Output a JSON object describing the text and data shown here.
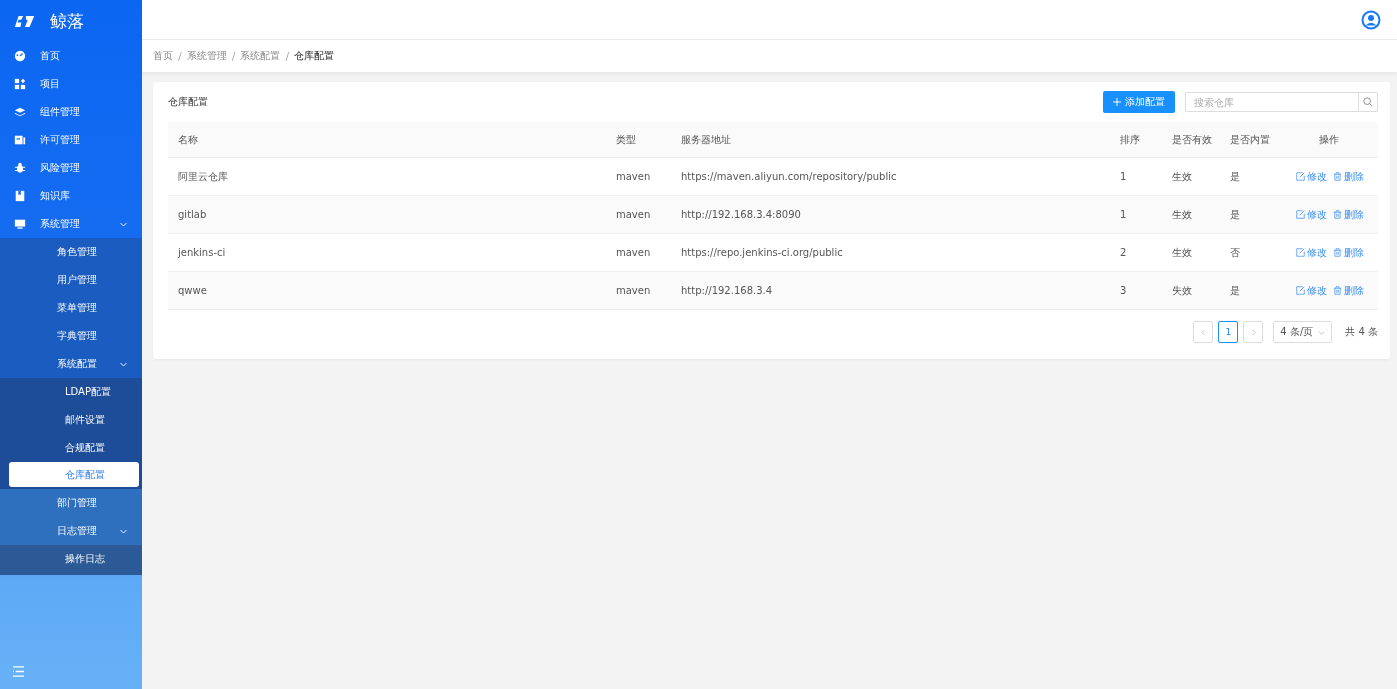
{
  "app": {
    "name": "鲸落"
  },
  "sidebar": {
    "items": [
      {
        "label": "首页",
        "selected": false
      },
      {
        "label": "项目",
        "selected": false
      },
      {
        "label": "组件管理",
        "selected": false
      },
      {
        "label": "许可管理",
        "selected": false
      },
      {
        "label": "风险管理",
        "selected": false
      },
      {
        "label": "知识库",
        "selected": false
      },
      {
        "label": "系统管理",
        "selected": false,
        "expanded": true,
        "children": [
          {
            "label": "角色管理",
            "selected": false
          },
          {
            "label": "用户管理",
            "selected": false
          },
          {
            "label": "菜单管理",
            "selected": false
          },
          {
            "label": "字典管理",
            "selected": false
          },
          {
            "label": "系统配置",
            "selected": false,
            "expanded": true,
            "children": [
              {
                "label": "LDAP配置",
                "selected": false
              },
              {
                "label": "邮件设置",
                "selected": false
              },
              {
                "label": "合规配置",
                "selected": false
              },
              {
                "label": "仓库配置",
                "selected": true
              }
            ]
          },
          {
            "label": "部门管理",
            "selected": false
          },
          {
            "label": "日志管理",
            "selected": false,
            "expanded": true,
            "children": [
              {
                "label": "操作日志",
                "selected": false
              }
            ]
          }
        ]
      }
    ]
  },
  "breadcrumb": {
    "separator": "/",
    "items": [
      "首页",
      "系统管理",
      "系统配置",
      "仓库配置"
    ]
  },
  "card": {
    "title": "仓库配置",
    "add_button": "添加配置",
    "search": {
      "placeholder": "搜索仓库"
    }
  },
  "table": {
    "columns": [
      "名称",
      "类型",
      "服务器地址",
      "排序",
      "是否有效",
      "是否内置",
      "操作"
    ],
    "rows": [
      {
        "name": "阿里云仓库",
        "type": "maven",
        "url": "https://maven.aliyun.com/repository/public",
        "order": "1",
        "valid": "生效",
        "builtin": "是",
        "edit": "修改",
        "delete": "删除"
      },
      {
        "name": "gitlab",
        "type": "maven",
        "url": "http://192.168.3.4:8090",
        "order": "1",
        "valid": "生效",
        "builtin": "是",
        "edit": "修改",
        "delete": "删除"
      },
      {
        "name": "jenkins-ci",
        "type": "maven",
        "url": "https://repo.jenkins-ci.org/public",
        "order": "2",
        "valid": "生效",
        "builtin": "否",
        "edit": "修改",
        "delete": "删除"
      },
      {
        "name": "qwwe",
        "type": "maven",
        "url": "http://192.168.3.4",
        "order": "3",
        "valid": "失效",
        "builtin": "是",
        "edit": "修改",
        "delete": "删除"
      }
    ]
  },
  "pagination": {
    "pages": [
      {
        "label": "1",
        "selected": true
      }
    ],
    "page_size": "4 条/页",
    "total": "共 4 条"
  }
}
